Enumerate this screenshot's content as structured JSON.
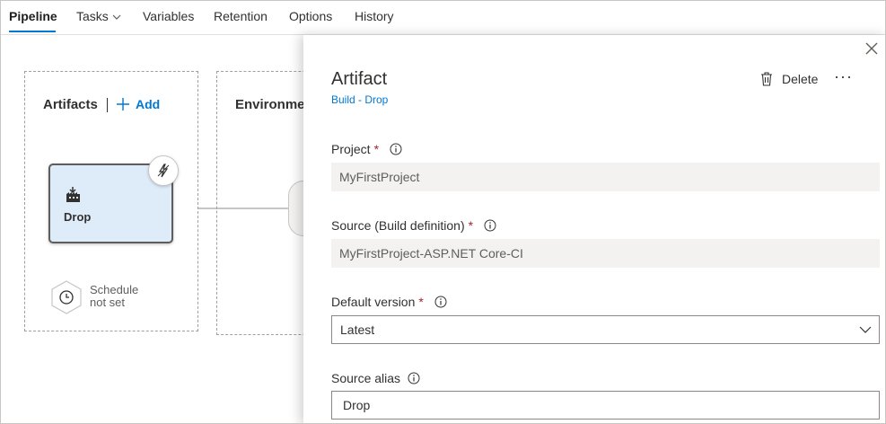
{
  "tabs": [
    {
      "label": "Pipeline"
    },
    {
      "label": "Tasks"
    },
    {
      "label": "Variables"
    },
    {
      "label": "Retention"
    },
    {
      "label": "Options"
    },
    {
      "label": "History"
    }
  ],
  "canvas": {
    "artifacts_title": "Artifacts",
    "add_label": "Add",
    "environments_title": "Environme",
    "artifact_card_name": "Drop",
    "schedule_line1": "Schedule",
    "schedule_line2": "not set"
  },
  "panel": {
    "title": "Artifact",
    "subtitle": "Build - Drop",
    "delete_label": "Delete",
    "more_label": "···",
    "fields": {
      "project": {
        "label": "Project",
        "required": "*",
        "value": "MyFirstProject"
      },
      "source": {
        "label": "Source (Build definition)",
        "required": "*",
        "value": "MyFirstProject-ASP.NET Core-CI"
      },
      "default_version": {
        "label": "Default version",
        "required": "*",
        "value": "Latest"
      },
      "source_alias": {
        "label": "Source alias",
        "value": "Drop"
      }
    }
  },
  "colors": {
    "accent": "#0078d4",
    "required": "#a4262c",
    "card_bg": "#deecf9",
    "readonly_bg": "#f3f2f1"
  },
  "icons": [
    "chevron-down-icon",
    "plus-icon",
    "build-icon",
    "trigger-icon",
    "clock-icon",
    "close-icon",
    "trash-icon",
    "info-icon"
  ]
}
